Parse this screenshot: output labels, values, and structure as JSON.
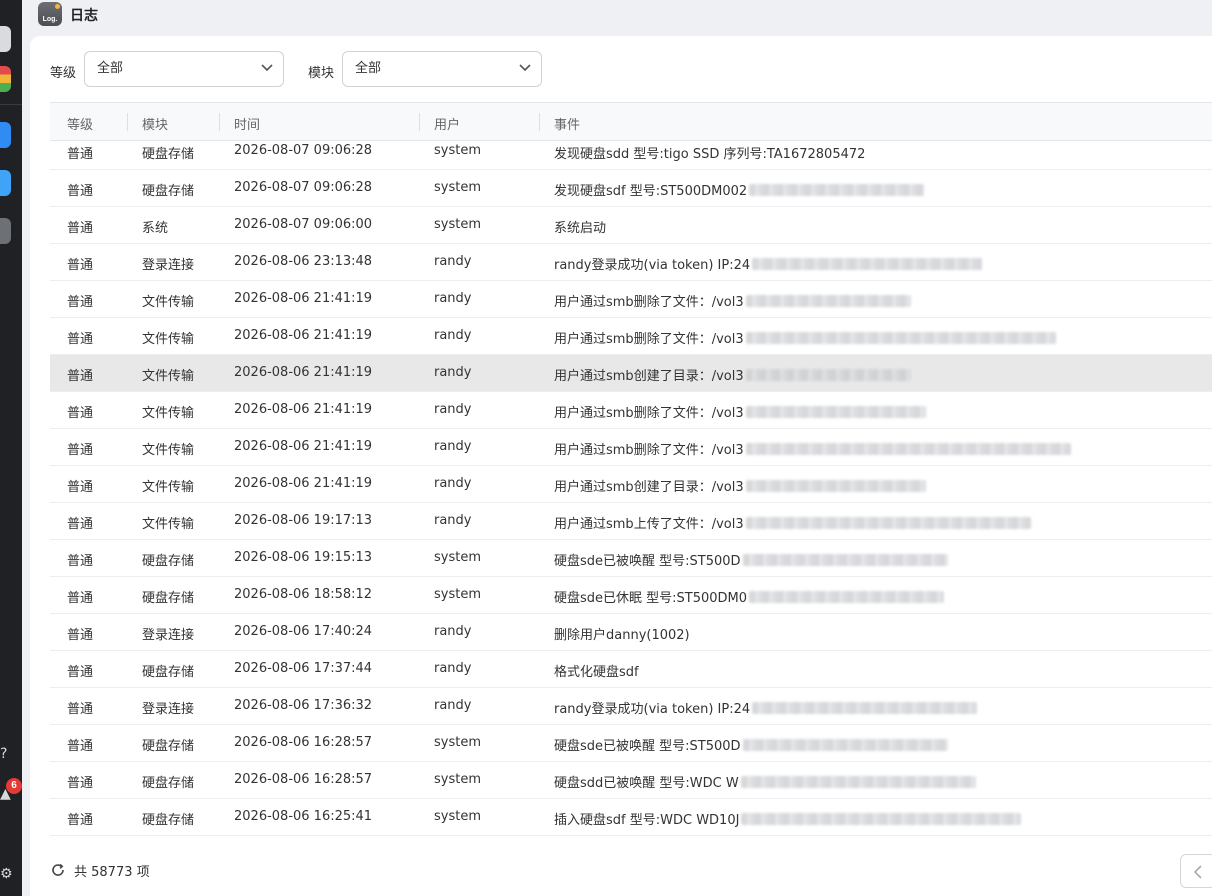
{
  "window": {
    "title": "日志",
    "app_icon_text": "Log."
  },
  "dock": {
    "badge_count": "6"
  },
  "filters": {
    "level_label": "等级",
    "level_value": "全部",
    "module_label": "模块",
    "module_value": "全部"
  },
  "table": {
    "columns": [
      "等级",
      "模块",
      "时间",
      "用户",
      "事件"
    ],
    "rows": [
      {
        "level": "普通",
        "module": "硬盘存储",
        "time": "2026-08-07 09:06:28",
        "user": "system",
        "event": "发现硬盘sdd 型号:tigo SSD 序列号:TA1672805472",
        "blur": 0
      },
      {
        "level": "普通",
        "module": "硬盘存储",
        "time": "2026-08-07 09:06:28",
        "user": "system",
        "event": "发现硬盘sdf 型号:ST500DM002",
        "blur": 175
      },
      {
        "level": "普通",
        "module": "系统",
        "time": "2026-08-07 09:06:00",
        "user": "system",
        "event": "系统启动",
        "blur": 0
      },
      {
        "level": "普通",
        "module": "登录连接",
        "time": "2026-08-06 23:13:48",
        "user": "randy",
        "event": "randy登录成功(via token) IP:24",
        "blur": 230
      },
      {
        "level": "普通",
        "module": "文件传输",
        "time": "2026-08-06 21:41:19",
        "user": "randy",
        "event": "用户通过smb删除了文件：/vol3",
        "blur": 165
      },
      {
        "level": "普通",
        "module": "文件传输",
        "time": "2026-08-06 21:41:19",
        "user": "randy",
        "event": "用户通过smb删除了文件：/vol3",
        "blur": 310
      },
      {
        "level": "普通",
        "module": "文件传输",
        "time": "2026-08-06 21:41:19",
        "user": "randy",
        "event": "用户通过smb创建了目录：/vol3",
        "blur": 165,
        "highlight": true
      },
      {
        "level": "普通",
        "module": "文件传输",
        "time": "2026-08-06 21:41:19",
        "user": "randy",
        "event": "用户通过smb删除了文件：/vol3",
        "blur": 180
      },
      {
        "level": "普通",
        "module": "文件传输",
        "time": "2026-08-06 21:41:19",
        "user": "randy",
        "event": "用户通过smb删除了文件：/vol3",
        "blur": 325
      },
      {
        "level": "普通",
        "module": "文件传输",
        "time": "2026-08-06 21:41:19",
        "user": "randy",
        "event": "用户通过smb创建了目录：/vol3",
        "blur": 180
      },
      {
        "level": "普通",
        "module": "文件传输",
        "time": "2026-08-06 19:17:13",
        "user": "randy",
        "event": "用户通过smb上传了文件：/vol3",
        "blur": 285
      },
      {
        "level": "普通",
        "module": "硬盘存储",
        "time": "2026-08-06 19:15:13",
        "user": "system",
        "event": "硬盘sde已被唤醒 型号:ST500D",
        "blur": 205
      },
      {
        "level": "普通",
        "module": "硬盘存储",
        "time": "2026-08-06 18:58:12",
        "user": "system",
        "event": "硬盘sde已休眠 型号:ST500DM0",
        "blur": 195
      },
      {
        "level": "普通",
        "module": "登录连接",
        "time": "2026-08-06 17:40:24",
        "user": "randy",
        "event": "删除用户danny(1002)",
        "blur": 0
      },
      {
        "level": "普通",
        "module": "硬盘存储",
        "time": "2026-08-06 17:37:44",
        "user": "randy",
        "event": "格式化硬盘sdf",
        "blur": 0
      },
      {
        "level": "普通",
        "module": "登录连接",
        "time": "2026-08-06 17:36:32",
        "user": "randy",
        "event": "randy登录成功(via token) IP:24",
        "blur": 225
      },
      {
        "level": "普通",
        "module": "硬盘存储",
        "time": "2026-08-06 16:28:57",
        "user": "system",
        "event": "硬盘sde已被唤醒 型号:ST500D",
        "blur": 205
      },
      {
        "level": "普通",
        "module": "硬盘存储",
        "time": "2026-08-06 16:28:57",
        "user": "system",
        "event": "硬盘sdd已被唤醒 型号:WDC W",
        "blur": 235
      },
      {
        "level": "普通",
        "module": "硬盘存储",
        "time": "2026-08-06 16:25:41",
        "user": "system",
        "event": "插入硬盘sdf 型号:WDC WD10J",
        "blur": 280
      }
    ]
  },
  "footer": {
    "total": "共 58773 项"
  },
  "colors": {
    "highlight_row": "#e8e8e8",
    "badge": "#e53935"
  }
}
